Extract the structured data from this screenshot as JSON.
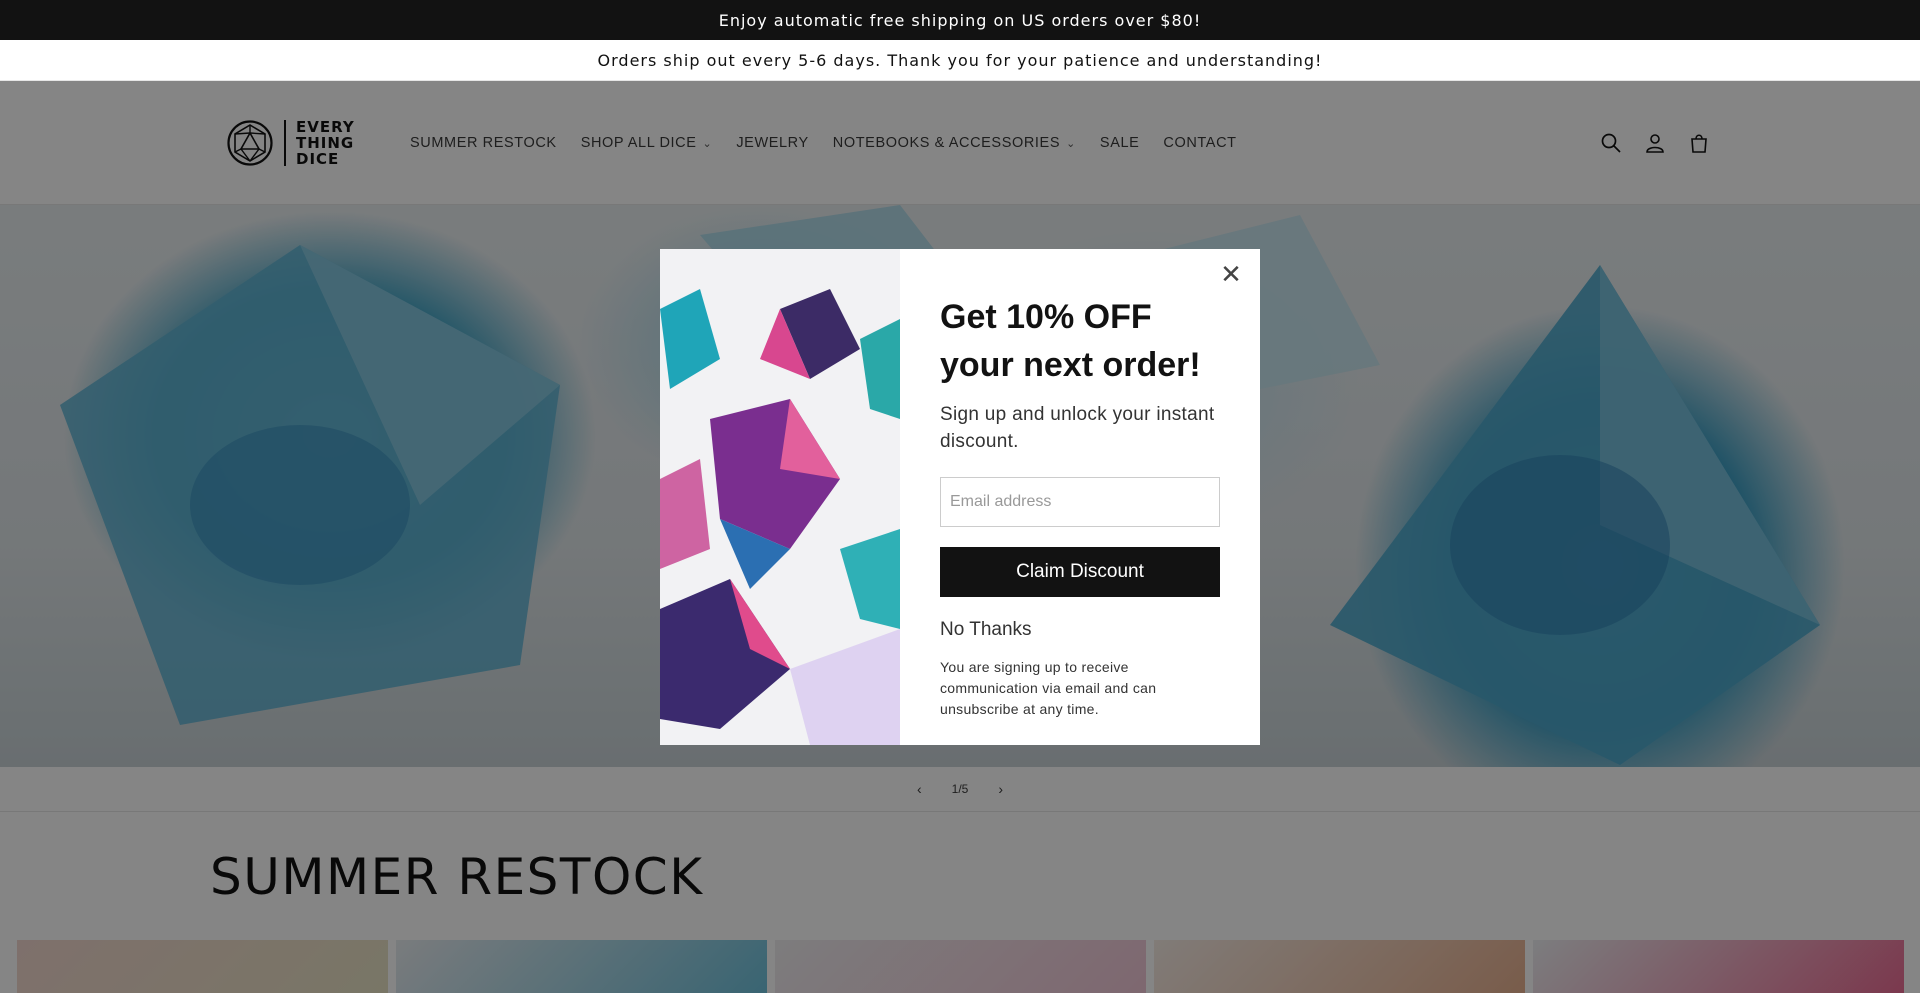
{
  "announcements": {
    "top": "Enjoy automatic free shipping on US orders over $80!",
    "second": "Orders ship out every 5-6 days. Thank you for your patience and understanding!"
  },
  "logo": {
    "line1": "EVERY",
    "line2": "THING",
    "line3": "DICE"
  },
  "nav": {
    "items": [
      {
        "label": "SUMMER RESTOCK"
      },
      {
        "label": "SHOP ALL DICE"
      },
      {
        "label": "JEWELRY"
      },
      {
        "label": "NOTEBOOKS & ACCESSORIES"
      },
      {
        "label": "SALE"
      },
      {
        "label": "CONTACT"
      }
    ]
  },
  "icons": {
    "search": "search-icon",
    "account": "account-icon",
    "cart": "cart-icon"
  },
  "slider": {
    "counter": "1/5",
    "prev": "‹",
    "next": "›"
  },
  "section": {
    "title": "SUMMER RESTOCK"
  },
  "modal": {
    "close": "✕",
    "title": "Get 10% OFF your next order!",
    "subtitle": "Sign up and unlock your instant discount.",
    "email_placeholder": "Email address",
    "claim_label": "Claim Discount",
    "no_thanks": "No Thanks",
    "disclaimer": "You are signing up to receive communication via email and can unsubscribe at any time."
  },
  "colors": {
    "dark": "#121212",
    "accent_blue": "#4aa8c8"
  }
}
